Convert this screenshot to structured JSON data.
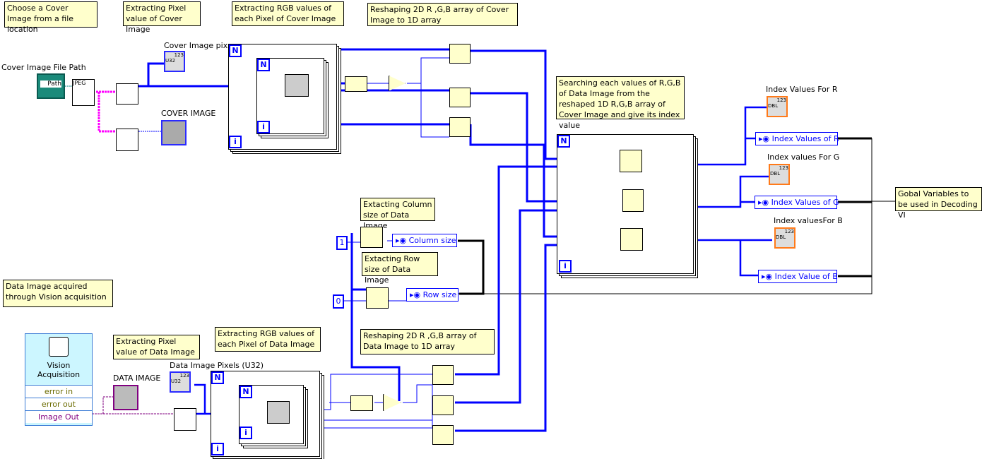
{
  "comments": {
    "choose_cover": "Choose a Cover Image from a file location",
    "extract_pixel_cover": "Extracting Pixel value of Cover Image",
    "extract_rgb_cover": "Extracting RGB values of each Pixel of Cover Image",
    "reshape_cover": "Reshaping 2D R ,G,B array of Cover Image to 1D array",
    "searching": "Searching each values of R,G,B of Data Image  from the reshaped 1D R,G,B array of Cover Image and give its index value",
    "global_vars": "Gobal Variables to be used in Decoding VI",
    "column_size": "Extacting Column size of Data Image",
    "row_size": "Extacting Row size of Data Image",
    "data_acquired": "Data Image acquired through Vision acquisition",
    "extract_pixel_data": "Extracting Pixel value of Data Image",
    "extract_rgb_data": "Extracting RGB values of each Pixel of Data Image",
    "reshape_data": "Reshaping 2D R ,G,B array of Data Image to 1D array"
  },
  "labels": {
    "cover_path": "Cover Image File Path",
    "cover_pixels": "Cover Image pixn",
    "cover_image": "COVER IMAGE",
    "index_r": "Index Values For R",
    "index_g": "Index values For G",
    "index_b": "Index valuesFor B",
    "data_image": "DATA IMAGE",
    "data_pixels": "Data Image Pixels (U32)"
  },
  "globals": {
    "r": "Index Values of R",
    "g": "Index Values of G",
    "b": "Index Value of B",
    "column": "Column size",
    "row": "Row size"
  },
  "constants": {
    "column_dim": "1",
    "row_dim": "0"
  },
  "vision": {
    "title": "Vision Acquisition",
    "error_in": "error in",
    "error_out": "error out",
    "image_out": "Image Out"
  },
  "nodes": {
    "path_ctrl": "Path",
    "jpeg": "JPEG",
    "loop_n": "N",
    "loop_i": "i",
    "num": "123",
    "u32": "U32",
    "dbl": "DBL"
  },
  "colors": {
    "wire_numeric": "#0000ff",
    "wire_image": "#ff00ff",
    "wire_refnum": "#800080",
    "comment_bg": "#ffffcc",
    "dbl_border": "#ff7a1a"
  }
}
